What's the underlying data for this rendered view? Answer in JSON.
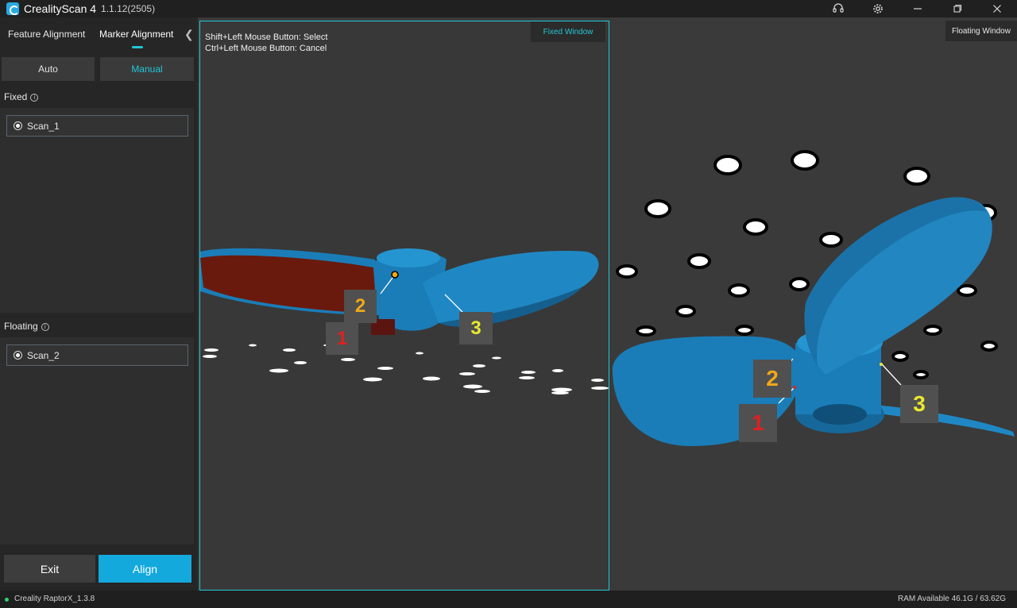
{
  "app": {
    "name": "CrealityScan 4",
    "version": "1.1.12(2505)"
  },
  "window_icons": {
    "support": "headset-icon",
    "settings": "gear-icon",
    "minimize": "minimize-icon",
    "restore": "restore-icon",
    "close": "close-icon"
  },
  "sidebar": {
    "tabs": [
      {
        "label": "Feature Alignment"
      },
      {
        "label": "Marker Alignment"
      }
    ],
    "active_tab": "Marker Alignment",
    "modes": {
      "auto": "Auto",
      "manual": "Manual",
      "active": "Manual"
    },
    "fixed": {
      "label": "Fixed",
      "scan": "Scan_1"
    },
    "floating": {
      "label": "Floating",
      "scan": "Scan_2"
    },
    "buttons": {
      "exit": "Exit",
      "align": "Align"
    }
  },
  "viewport": {
    "fixed_window_label": "Fixed Window",
    "floating_window_label": "Floating Window",
    "hint_select": "Shift+Left Mouse Button: Select",
    "hint_cancel": "Ctrl+Left Mouse Button: Cancel",
    "fixed_markers": [
      {
        "label": "1",
        "color": "#e02020"
      },
      {
        "label": "2",
        "color": "#f0a818"
      },
      {
        "label": "3",
        "color": "#e8e830"
      }
    ],
    "floating_markers": [
      {
        "label": "1",
        "color": "#e02020"
      },
      {
        "label": "2",
        "color": "#f0a818"
      },
      {
        "label": "3",
        "color": "#e8e830"
      }
    ]
  },
  "status": {
    "device": "Creality RaptorX_1.3.8",
    "ram": "RAM Available 46.1G / 63.62G"
  },
  "colors": {
    "accent": "#21c6d8",
    "align_button": "#13a9dd",
    "model_blue": "#1a7db8",
    "model_red": "#6a1a0c"
  }
}
